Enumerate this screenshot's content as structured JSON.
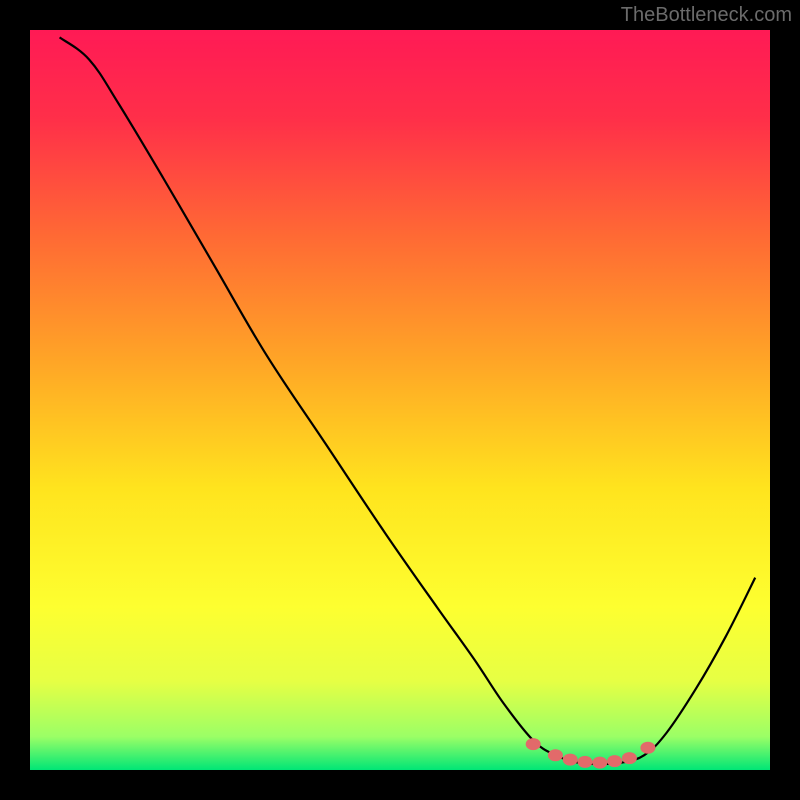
{
  "watermark": "TheBottleneck.com",
  "chart_data": {
    "type": "line",
    "title": "",
    "xlabel": "",
    "ylabel": "",
    "x_range": [
      0,
      100
    ],
    "y_range": [
      0,
      100
    ],
    "gradient_stops": [
      {
        "offset": 0,
        "color": "#ff1a55"
      },
      {
        "offset": 0.12,
        "color": "#ff2f49"
      },
      {
        "offset": 0.28,
        "color": "#ff6a34"
      },
      {
        "offset": 0.45,
        "color": "#ffa626"
      },
      {
        "offset": 0.62,
        "color": "#ffe41e"
      },
      {
        "offset": 0.78,
        "color": "#fdff30"
      },
      {
        "offset": 0.88,
        "color": "#e6ff44"
      },
      {
        "offset": 0.955,
        "color": "#9bff66"
      },
      {
        "offset": 1.0,
        "color": "#00e676"
      }
    ],
    "curve_points": [
      {
        "x": 4,
        "y": 99
      },
      {
        "x": 8,
        "y": 96
      },
      {
        "x": 12,
        "y": 90
      },
      {
        "x": 18,
        "y": 80
      },
      {
        "x": 25,
        "y": 68
      },
      {
        "x": 32,
        "y": 56
      },
      {
        "x": 40,
        "y": 44
      },
      {
        "x": 48,
        "y": 32
      },
      {
        "x": 55,
        "y": 22
      },
      {
        "x": 60,
        "y": 15
      },
      {
        "x": 64,
        "y": 9
      },
      {
        "x": 68,
        "y": 4
      },
      {
        "x": 71,
        "y": 2
      },
      {
        "x": 74,
        "y": 1
      },
      {
        "x": 77,
        "y": 0.8
      },
      {
        "x": 80,
        "y": 1
      },
      {
        "x": 83,
        "y": 2
      },
      {
        "x": 86,
        "y": 5
      },
      {
        "x": 90,
        "y": 11
      },
      {
        "x": 94,
        "y": 18
      },
      {
        "x": 98,
        "y": 26
      }
    ],
    "markers": [
      {
        "x": 68,
        "y": 3.5
      },
      {
        "x": 71,
        "y": 2
      },
      {
        "x": 73,
        "y": 1.4
      },
      {
        "x": 75,
        "y": 1.1
      },
      {
        "x": 77,
        "y": 1
      },
      {
        "x": 79,
        "y": 1.2
      },
      {
        "x": 81,
        "y": 1.6
      },
      {
        "x": 83.5,
        "y": 3
      }
    ],
    "marker_color": "#e26a6a",
    "curve_color": "#000000"
  }
}
